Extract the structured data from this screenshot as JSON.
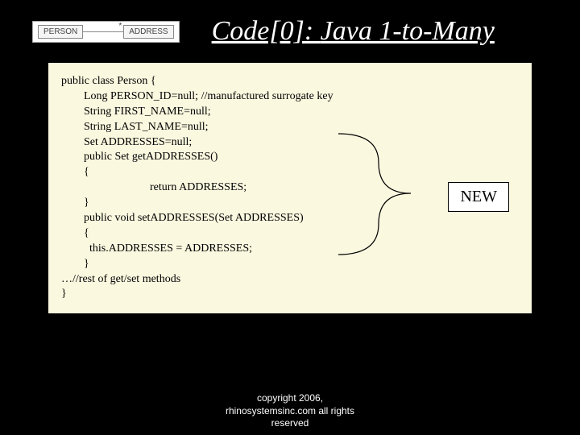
{
  "title": {
    "prefix": "Code[0]: ",
    "main": "Java 1-to-Many"
  },
  "uml": {
    "left": "PERSON",
    "right": "ADDRESS",
    "multiplicity": "*"
  },
  "code": {
    "l0": "public class Person {",
    "l1": "Long PERSON_ID=null; //manufactured surrogate key",
    "l2": "String FIRST_NAME=null;",
    "l3": "String LAST_NAME=null;",
    "l4": "Set ADDRESSES=null;",
    "l5": "public Set getADDRESSES()",
    "l6": "{",
    "l7": "return ADDRESSES;",
    "l8": "}",
    "l9": "public void setADDRESSES(Set ADDRESSES)",
    "l10": "{",
    "l11": "  this.ADDRESSES = ADDRESSES;",
    "l12": "}",
    "l13": "…//rest of get/set methods",
    "l14": "}"
  },
  "badge": "NEW",
  "footer": {
    "line1": "copyright 2006,",
    "line2": "rhinosystemsinc.com all rights",
    "line3": "reserved"
  }
}
